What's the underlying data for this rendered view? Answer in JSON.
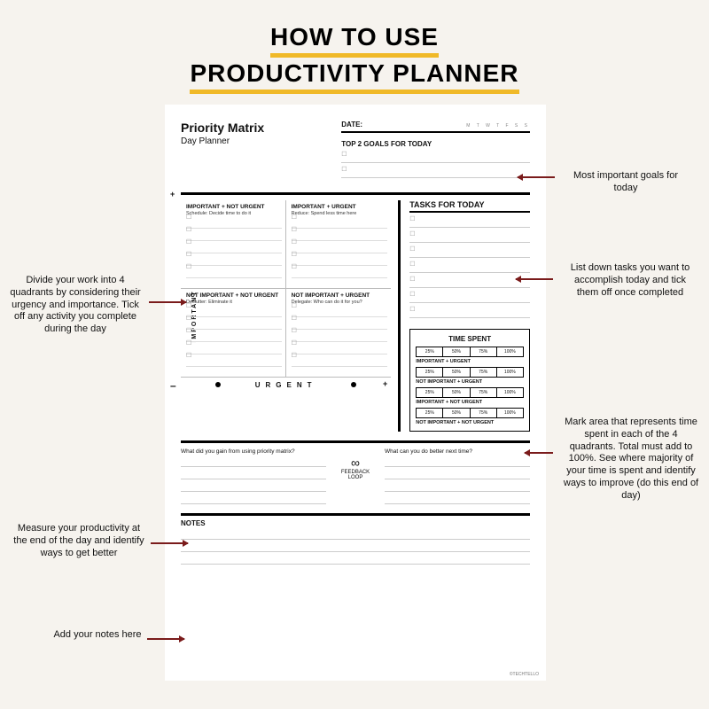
{
  "title_line1": "HOW TO USE",
  "title_line2": "PRODUCTIVITY PLANNER",
  "planner": {
    "heading": "Priority Matrix",
    "subheading": "Day Planner",
    "date_label": "DATE:",
    "weekdays": "M T W T F S S",
    "top_goals_label": "TOP 2 GOALS FOR TODAY",
    "axis_important": "IMPORTANT",
    "axis_urgent": "URGENT",
    "quadrants": {
      "q1_head": "IMPORTANT + NOT URGENT",
      "q1_sub": "Schedule: Decide time to do it",
      "q2_head": "IMPORTANT + URGENT",
      "q2_sub": "Reduce: Spend less time here",
      "q3_head": "NOT IMPORTANT + NOT URGENT",
      "q3_sub": "Declutter: Eliminate it",
      "q4_head": "NOT IMPORTANT + URGENT",
      "q4_sub": "Delegate: Who can do it for you?"
    },
    "tasks_label": "TASKS FOR TODAY",
    "time_spent": {
      "title": "TIME SPENT",
      "percents": [
        "25%",
        "50%",
        "75%",
        "100%"
      ],
      "row1": "IMPORTANT + URGENT",
      "row2": "NOT IMPORTANT + URGENT",
      "row3": "IMPORTANT + NOT URGENT",
      "row4": "NOT IMPORTANT + NOT URGENT"
    },
    "feedback": {
      "q_left": "What did you gain from using priority matrix?",
      "q_right": "What can you do better next time?",
      "center1": "FEEDBACK",
      "center2": "LOOP"
    },
    "notes_label": "NOTES",
    "attribution": "©TECHTELLO"
  },
  "annotations": {
    "goals": "Most important goals for today",
    "tasks": "List down tasks you want to accomplish today and tick them off once completed",
    "quadrants": "Divide your work into 4 quadrants by considering their urgency and importance. Tick off any activity you complete during the day",
    "timespent": "Mark area that represents time spent in each of the 4 quadrants. Total must add to 100%. See where majority of your time is spent and identify ways to improve (do this end of day)",
    "feedback": "Measure your productivity at the end of the day and identify ways to get better",
    "notes": "Add your notes here"
  }
}
